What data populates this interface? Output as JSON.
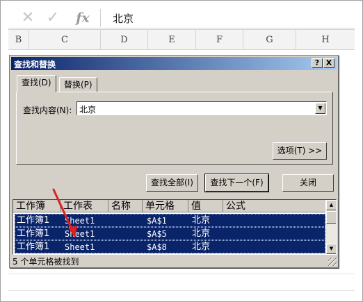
{
  "formula_bar": {
    "cancel_icon": "x-icon",
    "enter_icon": "check-icon",
    "fx_label": "fx",
    "value": "北京"
  },
  "columns": [
    "B",
    "C",
    "D",
    "E",
    "F",
    "G",
    "H"
  ],
  "dialog": {
    "title": "查找和替换",
    "help_label": "?",
    "close_label": "X",
    "tabs": {
      "find": "查找(D)",
      "replace": "替换(P)"
    },
    "find_label": "查找内容(N):",
    "find_value": "北京",
    "options_button": "选项(T) >>",
    "find_all_button": "查找全部(I)",
    "find_next_button": "查找下一个(F)",
    "close_button": "关闭",
    "results": {
      "headers": [
        "工作簿",
        "工作表",
        "名称",
        "单元格",
        "值",
        "公式"
      ],
      "rows": [
        {
          "book": "工作簿1",
          "sheet": "Sheet1",
          "name": "",
          "cell": "$A$1",
          "value": "北京",
          "formula": ""
        },
        {
          "book": "工作簿1",
          "sheet": "Sheet1",
          "name": "",
          "cell": "$A$5",
          "value": "北京",
          "formula": ""
        },
        {
          "book": "工作簿1",
          "sheet": "Sheet1",
          "name": "",
          "cell": "$A$8",
          "value": "北京",
          "formula": ""
        }
      ]
    },
    "status": "5 个单元格被找到"
  },
  "colors": {
    "title_start": "#0a246a",
    "title_end": "#a6caf0",
    "selection": "#0a246a",
    "annotation_arrow": "#e02020",
    "dialog_face": "#d4d0c8"
  }
}
